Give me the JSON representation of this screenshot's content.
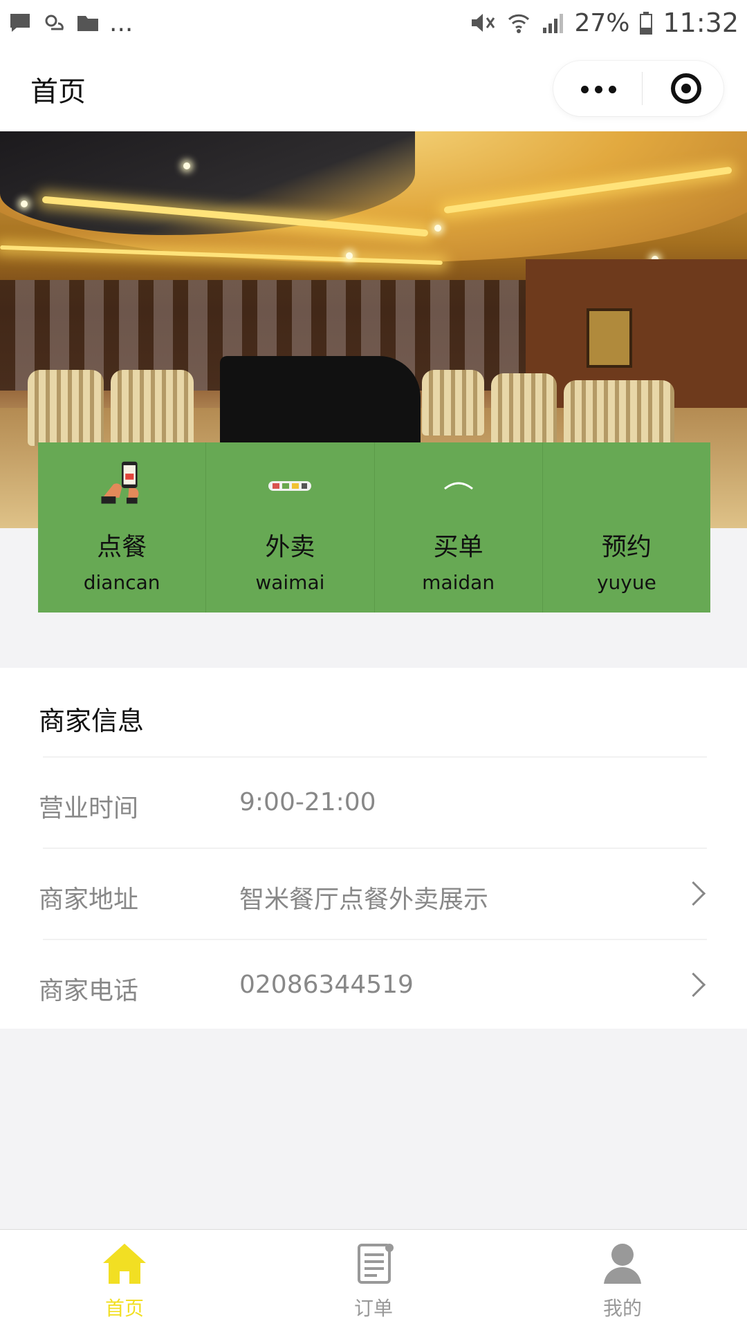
{
  "status_bar": {
    "more_indicator": "...",
    "battery": "27%",
    "time": "11:32",
    "icons": [
      "message-icon",
      "weather-icon",
      "folder-icon",
      "mute-icon",
      "wifi-icon",
      "signal-icon",
      "battery-icon"
    ]
  },
  "navbar": {
    "title": "首页",
    "more_icon": "more-dots-icon",
    "close_icon": "target-close-icon"
  },
  "menu": [
    {
      "label": "点餐",
      "sub": "diancan",
      "icon": "phone-order-icon"
    },
    {
      "label": "外卖",
      "sub": "waimai",
      "icon": "delivery-badge-icon"
    },
    {
      "label": "买单",
      "sub": "maidan",
      "icon": "arc-icon"
    },
    {
      "label": "预约",
      "sub": "yuyue",
      "icon": ""
    }
  ],
  "merchant": {
    "title": "商家信息",
    "rows": [
      {
        "label": "营业时间",
        "value": "9:00-21:00",
        "has_chevron": false
      },
      {
        "label": "商家地址",
        "value": "智米餐厅点餐外卖展示",
        "has_chevron": true
      },
      {
        "label": "商家电话",
        "value": "02086344519",
        "has_chevron": true
      }
    ]
  },
  "tabbar": {
    "tabs": [
      {
        "label": "首页",
        "icon": "home-icon",
        "active": true
      },
      {
        "label": "订单",
        "icon": "order-list-icon",
        "active": false
      },
      {
        "label": "我的",
        "icon": "user-icon",
        "active": false
      }
    ],
    "active_color": "#f2df23",
    "inactive_color": "#999999"
  },
  "colors": {
    "menu_bg": "#67a954",
    "page_bg": "#f3f3f5"
  }
}
